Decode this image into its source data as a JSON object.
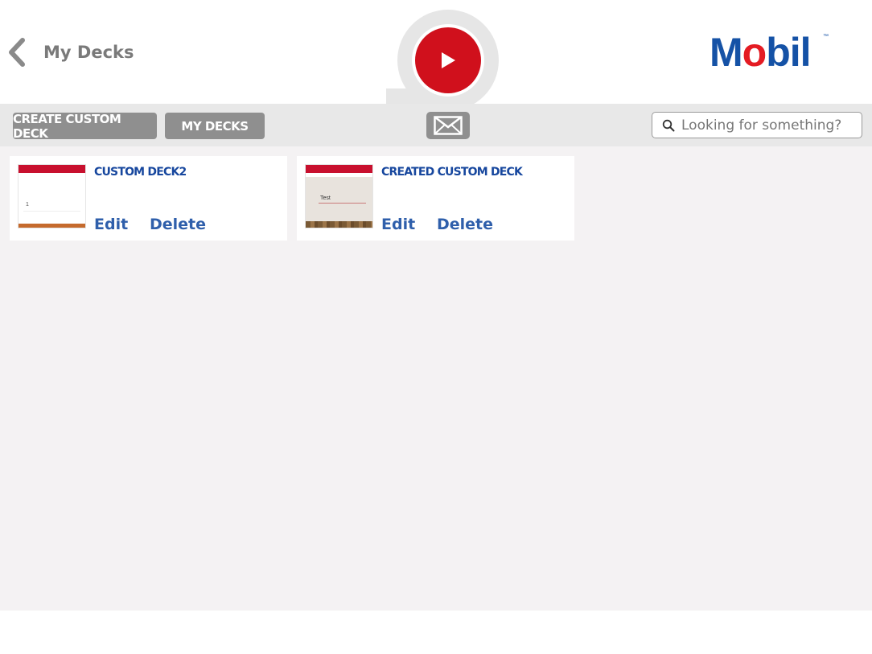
{
  "header": {
    "back_label": "My Decks",
    "logo": "Mobil",
    "logo_tm": "™"
  },
  "toolbar": {
    "create_label": "CREATE CUSTOM DECK",
    "mydecks_label": "MY DECKS",
    "search_placeholder": "Looking for something?"
  },
  "decks": [
    {
      "title": "CUSTOM DECK2",
      "thumb_number": "1",
      "edit_label": "Edit",
      "delete_label": "Delete"
    },
    {
      "title": "CREATED CUSTOM DECK",
      "thumb_text": "Test",
      "edit_label": "Edit",
      "delete_label": "Delete"
    }
  ],
  "colors": {
    "brand_red": "#d0101c",
    "brand_blue": "#1552a6",
    "link_blue": "#2f5fab",
    "button_gray": "#8f8f8f"
  }
}
